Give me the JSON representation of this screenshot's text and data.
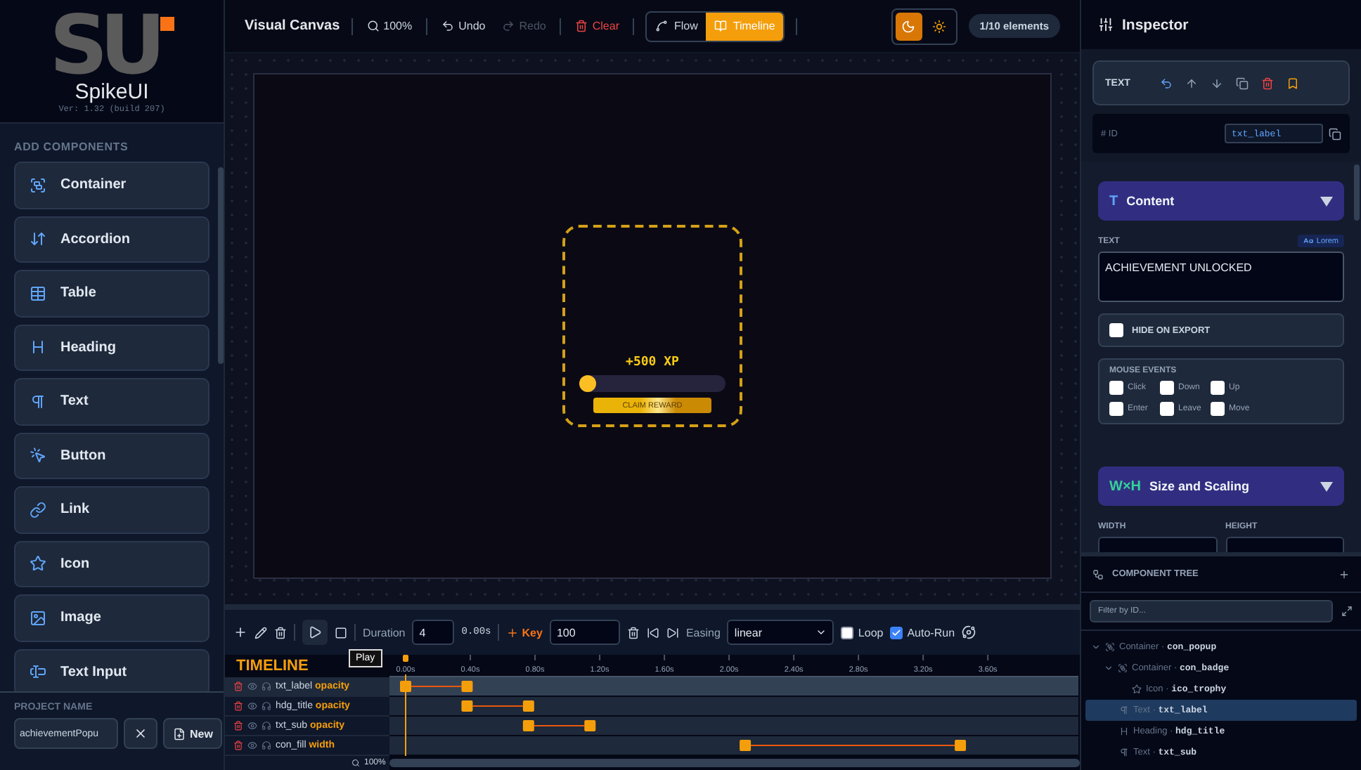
{
  "sidebar": {
    "logo": {
      "mark": "SU",
      "name": "SpikeUI",
      "version": "Ver: 1.32 (build 207)"
    },
    "section_title": "ADD COMPONENTS",
    "components": [
      {
        "kind": "container",
        "label": "Container"
      },
      {
        "kind": "accordion",
        "label": "Accordion"
      },
      {
        "kind": "table",
        "label": "Table"
      },
      {
        "kind": "heading",
        "label": "Heading"
      },
      {
        "kind": "text",
        "label": "Text"
      },
      {
        "kind": "button",
        "label": "Button"
      },
      {
        "kind": "link",
        "label": "Link"
      },
      {
        "kind": "icon",
        "label": "Icon"
      },
      {
        "kind": "image",
        "label": "Image"
      },
      {
        "kind": "input",
        "label": "Text Input"
      }
    ],
    "project": {
      "title": "PROJECT NAME",
      "value": "achievementPopu",
      "new_button": "New"
    }
  },
  "toolbar": {
    "title": "Visual Canvas",
    "zoom": "100%",
    "undo": {
      "label": "Undo",
      "disabled": false
    },
    "redo": {
      "label": "Redo",
      "disabled": true
    },
    "clear": "Clear",
    "modes": [
      {
        "kind": "flow",
        "label": "Flow",
        "selected": false
      },
      {
        "kind": "timeline",
        "label": "Timeline",
        "selected": true
      }
    ],
    "themes": [
      {
        "kind": "dark",
        "selected": true
      },
      {
        "kind": "light",
        "selected": false
      }
    ],
    "count": "1/10 elements"
  },
  "canvas": {
    "popup": {
      "xp": "+500 XP",
      "progress": {
        "level": 0.05
      },
      "button": "CLAIM REWARD"
    }
  },
  "timeline_toolbar": {
    "duration_label": "Duration",
    "duration": "4",
    "time": "0.00s",
    "key_button": "Key",
    "key_value": "100",
    "easing_label": "Easing",
    "easing": "linear",
    "loop": {
      "label": "Loop",
      "checked": false
    },
    "auto_run": {
      "label": "Auto-Run",
      "checked": true
    },
    "tooltip": "Play"
  },
  "timeline": {
    "title": "TIMELINE",
    "zoom": "100%",
    "tracks": [
      {
        "selected": true
      },
      {
        "selected": false
      },
      {
        "selected": false
      },
      {
        "selected": false
      }
    ],
    "chart_data": {
      "type": "scatter",
      "orientation": "horizontal",
      "categories": [
        "txt_label **opacity**",
        "hdg_title **opacity**",
        "txt_sub **opacity**",
        "con_fill **width**"
      ],
      "xlim": [
        -0.1,
        4.16
      ],
      "ref_lines": [
        {
          "axis": "x",
          "value": 0
        }
      ],
      "xticks": [
        {
          "value": 0,
          "label": "0.00s"
        },
        {
          "value": 0.4,
          "label": "0.40s"
        },
        {
          "value": 0.8,
          "label": "0.80s"
        },
        {
          "value": 1.2,
          "label": "1.20s"
        },
        {
          "value": 1.6,
          "label": "1.60s"
        },
        {
          "value": 2,
          "label": "2.00s"
        },
        {
          "value": 2.4,
          "label": "2.40s"
        },
        {
          "value": 2.8,
          "label": "2.80s"
        },
        {
          "value": 3.2,
          "label": "3.20s"
        },
        {
          "value": 3.6,
          "label": "3.60s"
        }
      ],
      "series": [
        {
          "values": [
            0,
            0.38,
            0.76,
            2.1
          ]
        },
        {
          "values": [
            0.38,
            0.76,
            1.14,
            3.43
          ]
        }
      ]
    }
  },
  "inspector": {
    "title": "Inspector",
    "element_type": "TEXT",
    "id": {
      "label": "# ID",
      "value": "txt_label"
    },
    "content": {
      "icon_text": "T",
      "title": "Content",
      "expanded": true,
      "text_label": "TEXT",
      "lorem": "Lorem",
      "text": "ACHIEVEMENT UNLOCKED",
      "hide_on_export": {
        "label": "HIDE ON EXPORT",
        "checked": false
      },
      "mouse_events": {
        "title": "MOUSE EVENTS",
        "options": [
          {
            "label": "Click",
            "checked": false
          },
          {
            "label": "Down",
            "checked": false
          },
          {
            "label": "Up",
            "checked": false
          },
          {
            "label": "Enter",
            "checked": false
          },
          {
            "label": "Leave",
            "checked": false
          },
          {
            "label": "Move",
            "checked": false
          }
        ]
      }
    },
    "size": {
      "icon_text": "W×H",
      "title": "Size and Scaling",
      "expanded": true,
      "fields": [
        "WIDTH",
        "HEIGHT"
      ]
    }
  },
  "tree": {
    "title": "COMPONENT TREE",
    "filter_placeholder": "Filter by ID...",
    "separator": "·",
    "nodes": [
      {
        "kind": "container",
        "type": "Container",
        "id": "con_popup",
        "expanded": true,
        "selected": false,
        "children": [
          {
            "kind": "container",
            "type": "Container",
            "id": "con_badge",
            "expanded": true,
            "selected": false,
            "children": [
              {
                "kind": "icon",
                "type": "Icon",
                "id": "ico_trophy",
                "selected": false
              }
            ]
          },
          {
            "kind": "text",
            "type": "Text",
            "id": "txt_label",
            "selected": true
          },
          {
            "kind": "heading",
            "type": "Heading",
            "id": "hdg_title",
            "selected": false
          },
          {
            "kind": "text",
            "type": "Text",
            "id": "txt_sub",
            "selected": false
          }
        ]
      }
    ]
  }
}
